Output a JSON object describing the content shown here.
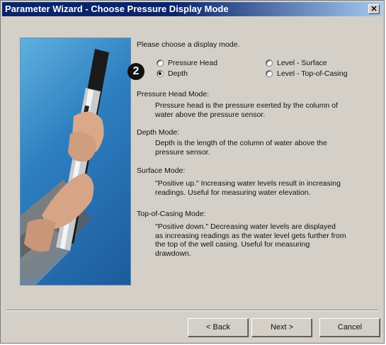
{
  "window": {
    "title": "Parameter Wizard - Choose Pressure Display Mode"
  },
  "badge": "2",
  "prompt": "Please choose a display mode.",
  "options": [
    {
      "label": "Pressure Head",
      "checked": false
    },
    {
      "label": "Depth",
      "checked": true
    },
    {
      "label": "Level - Surface",
      "checked": false
    },
    {
      "label": "Level - Top-of-Casing",
      "checked": false
    }
  ],
  "sections": [
    {
      "title": "Pressure Head Mode:",
      "lines": [
        "Pressure head is the pressure exerted by the column of",
        "water above the pressure sensor."
      ]
    },
    {
      "title": "Depth Mode:",
      "lines": [
        "Depth is the length of the column of water above the",
        "pressure sensor."
      ]
    },
    {
      "title": "Surface Mode:",
      "lines": [
        "\"Positive up.\"  Increasing water levels result in increasing",
        "readings.  Useful for measuring water elevation."
      ]
    },
    {
      "title": "Top-of-Casing Mode:",
      "lines": [
        "\"Positive down.\"  Decreasing water levels are displayed",
        "as increasing readings as the water level gets further from",
        "the top of the well casing.  Useful for measuring",
        "drawdown."
      ]
    }
  ],
  "buttons": {
    "back": "< Back",
    "next": "Next >",
    "cancel": "Cancel"
  }
}
